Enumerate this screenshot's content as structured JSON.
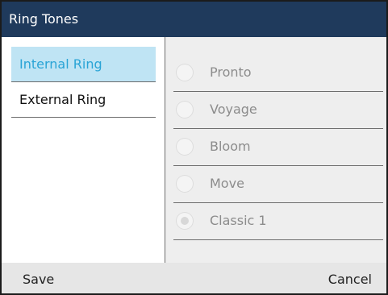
{
  "header": {
    "title": "Ring Tones"
  },
  "left_menu": {
    "items": [
      {
        "label": "Internal Ring",
        "selected": true
      },
      {
        "label": "External Ring",
        "selected": false
      }
    ]
  },
  "options": {
    "items": [
      {
        "label": "Pronto",
        "checked": false
      },
      {
        "label": "Voyage",
        "checked": false
      },
      {
        "label": "Bloom",
        "checked": false
      },
      {
        "label": "Move",
        "checked": false
      },
      {
        "label": "Classic 1",
        "checked": true
      }
    ]
  },
  "softkeys": {
    "save_label": "Save",
    "cancel_label": "Cancel"
  },
  "colors": {
    "titlebar": "#1f3a5c",
    "selected_bg": "#bfe4f4",
    "selected_text": "#2aa4d6",
    "options_bg": "#eeeeee",
    "softkey_bg": "#e6e6e6"
  }
}
